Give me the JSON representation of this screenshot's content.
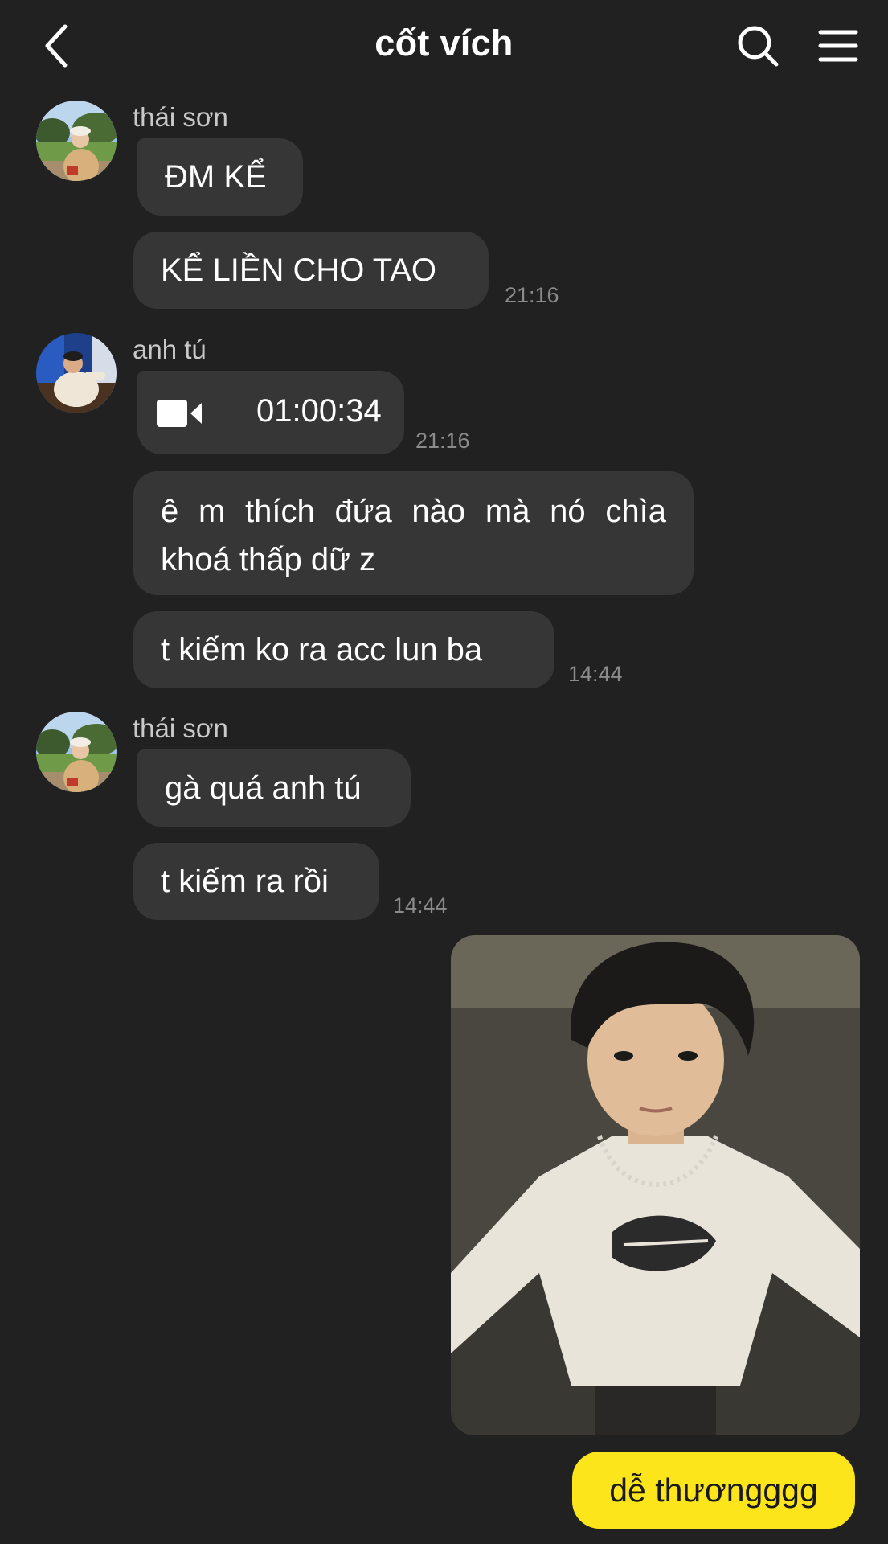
{
  "header": {
    "title": "cốt vích",
    "back_icon": "chevron-left-icon",
    "search_icon": "search-icon",
    "menu_icon": "hamburger-menu-icon"
  },
  "messages": {
    "group1": {
      "sender": "thái sơn",
      "bubbles": [
        "ĐM KỂ",
        "KỂ LIỀN CHO TAO"
      ],
      "time": "21:16"
    },
    "group2": {
      "sender": "anh tú",
      "call": {
        "icon": "video-camera-icon",
        "duration": "01:00:34",
        "time": "21:16"
      },
      "bubbles": [
        "ê m thích đứa nào mà nó chìa khoá thấp dữ z",
        "t kiếm ko ra acc lun ba"
      ],
      "time": "14:44"
    },
    "group3": {
      "sender": "thái sơn",
      "bubbles": [
        "gà quá anh tú",
        "t kiếm ra rồi"
      ],
      "time": "14:44"
    },
    "outgoing": {
      "photo": "selfie-photo",
      "text": "dễ thươngggg"
    }
  },
  "colors": {
    "background": "#212121",
    "incoming_bubble": "#363636",
    "outgoing_bubble": "#fce51a",
    "timestamp": "#8b8b8b",
    "sender_name": "#c9c9c9"
  }
}
